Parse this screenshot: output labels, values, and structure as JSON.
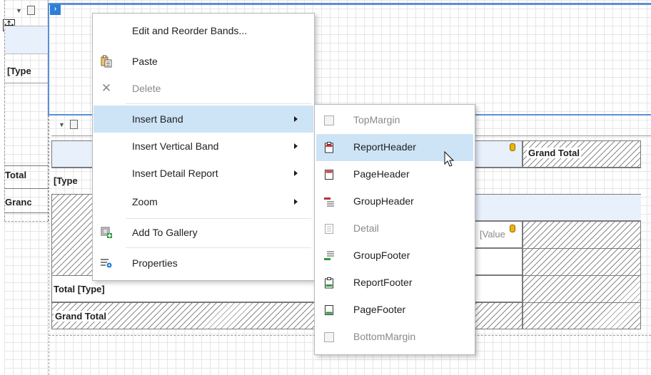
{
  "report": {
    "type_placeholder_1": "[Type",
    "type_placeholder_2": "[Type",
    "total_1": "Total",
    "grand_1": "Granc",
    "grand_total_header": "Grand Total",
    "value_placeholder": "[Value",
    "total_type": "Total [Type]",
    "grand_total_row": "Grand Total"
  },
  "context_menu": {
    "items": [
      {
        "label": "Edit and Reorder Bands...",
        "icon": "",
        "disabled": false
      },
      {
        "label": "Paste",
        "icon": "paste-icon",
        "disabled": false
      },
      {
        "label": "Delete",
        "icon": "delete-icon",
        "disabled": true
      },
      {
        "label": "Insert Band",
        "icon": "",
        "disabled": false,
        "submenu": true,
        "active": true
      },
      {
        "label": "Insert Vertical Band",
        "icon": "",
        "disabled": false,
        "submenu": true
      },
      {
        "label": "Insert Detail Report",
        "icon": "",
        "disabled": false,
        "submenu": true
      },
      {
        "label": "Zoom",
        "icon": "",
        "disabled": false,
        "submenu": true
      },
      {
        "label": "Add To Gallery",
        "icon": "add-to-gallery-icon",
        "disabled": false
      },
      {
        "label": "Properties",
        "icon": "properties-icon",
        "disabled": false
      }
    ]
  },
  "insert_band_submenu": {
    "items": [
      {
        "label": "TopMargin",
        "icon": "top-margin-icon",
        "disabled": true
      },
      {
        "label": "ReportHeader",
        "icon": "report-header-icon",
        "disabled": false,
        "active": true
      },
      {
        "label": "PageHeader",
        "icon": "page-header-icon",
        "disabled": false
      },
      {
        "label": "GroupHeader",
        "icon": "group-header-icon",
        "disabled": false
      },
      {
        "label": "Detail",
        "icon": "detail-icon",
        "disabled": true
      },
      {
        "label": "GroupFooter",
        "icon": "group-footer-icon",
        "disabled": false
      },
      {
        "label": "ReportFooter",
        "icon": "report-footer-icon",
        "disabled": false
      },
      {
        "label": "PageFooter",
        "icon": "page-footer-icon",
        "disabled": false
      },
      {
        "label": "BottomMargin",
        "icon": "bottom-margin-icon",
        "disabled": true
      }
    ]
  },
  "colors": {
    "accent": "#2b7fd6",
    "menu_highlight": "#cde4f7",
    "band_header": "#e8f0fb",
    "disabled_text": "#8a8a8a"
  }
}
